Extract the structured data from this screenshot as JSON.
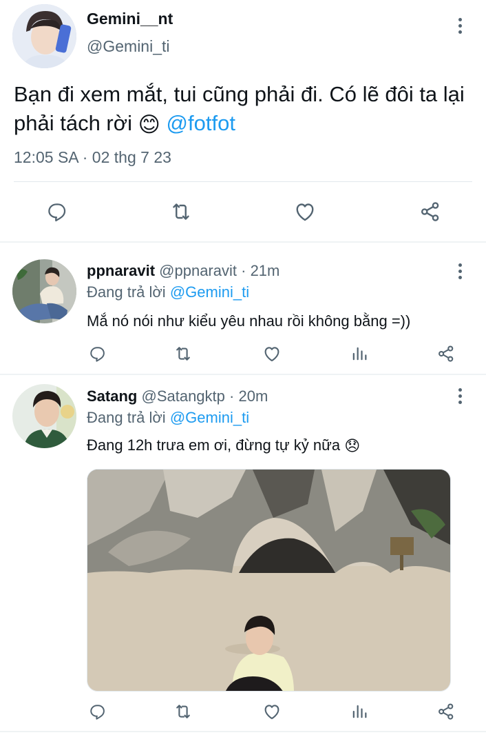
{
  "main_tweet": {
    "display_name": "Gemini__nt",
    "handle": "@Gemini_ti",
    "text": "Bạn đi xem mắt, tui cũng phải đi. Có lẽ đôi ta lại phải tách rời",
    "emoji": "😊",
    "mention": "@fotfot",
    "timestamp": "12:05 SA · 02 thg 7 23",
    "actions": [
      "reply-icon",
      "retweet-icon",
      "like-icon",
      "share-icon"
    ]
  },
  "replies": [
    {
      "display_name": "ppnaravit",
      "handle": "@ppnaravit",
      "time": "· 21m",
      "replying_prefix": "Đang trả lời",
      "replying_to": "@Gemini_ti",
      "text": "Mắ nó nói như kiểu yêu nhau rồi không bằng =))"
    },
    {
      "display_name": "Satang",
      "handle": "@Satangktp",
      "time": "· 20m",
      "replying_prefix": "Đang trả lời",
      "replying_to": "@Gemini_ti",
      "text": "Đang 12h trưa em ơi, đừng tự kỷ nữa",
      "emoji": "😞",
      "has_media": true
    }
  ],
  "colors": {
    "accent": "#1d9bf0",
    "icon": "#536471",
    "text": "#0f1419",
    "divider": "#eff3f4"
  }
}
